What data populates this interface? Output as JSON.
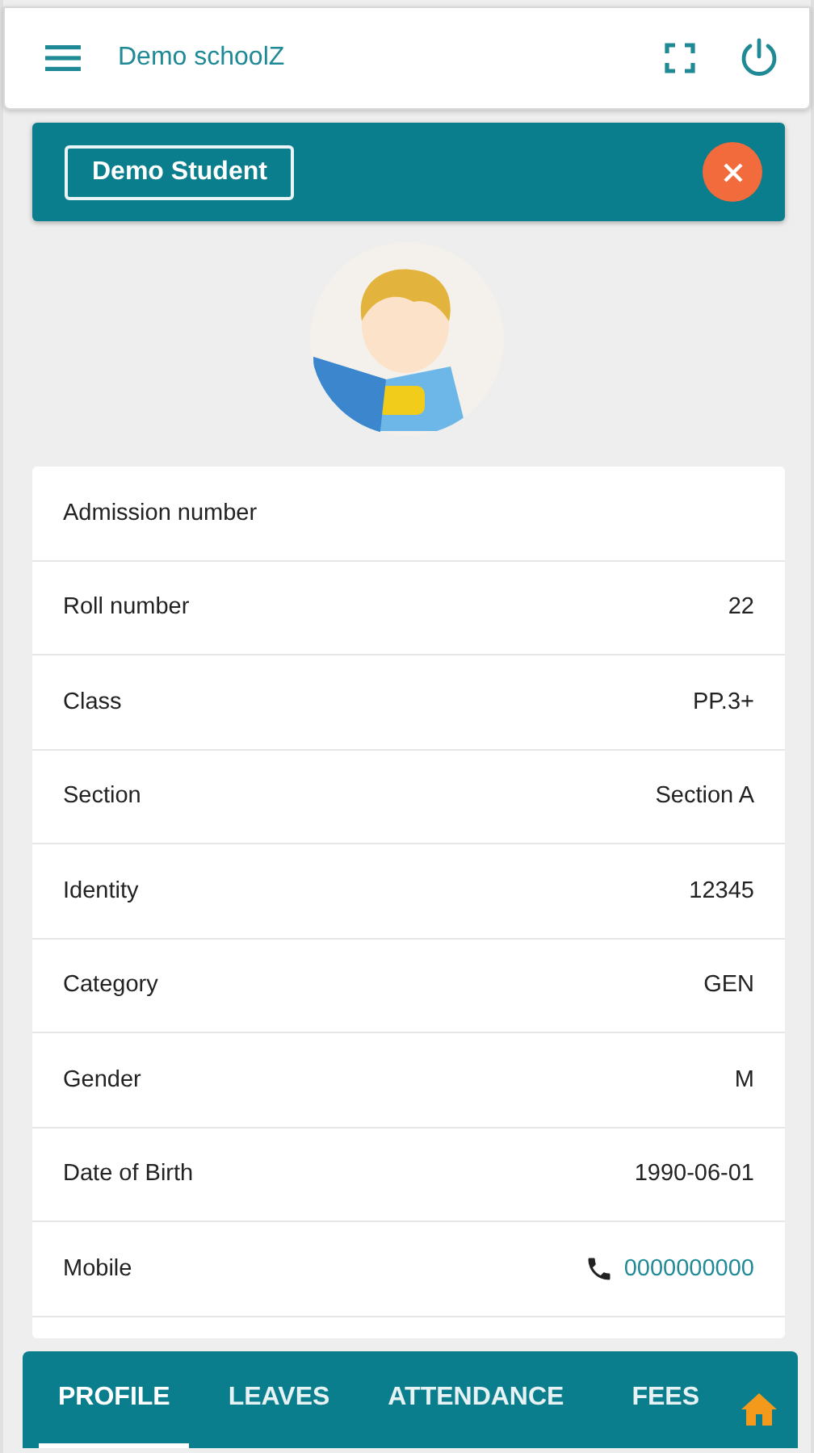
{
  "header": {
    "title": "Demo schoolZ"
  },
  "banner": {
    "name": "Demo Student"
  },
  "fields": [
    {
      "label": "Admission number"
    },
    {
      "label": "Roll number",
      "value": "22",
      "kind": "text"
    },
    {
      "label": "Class",
      "value": "PP.3+",
      "kind": "text"
    },
    {
      "label": "Section",
      "value": "Section A",
      "kind": "text"
    },
    {
      "label": "Identity",
      "value": "12345",
      "kind": "text"
    },
    {
      "label": "Category",
      "value": "GEN",
      "kind": "text"
    },
    {
      "label": "Gender",
      "value": "M",
      "kind": "text"
    },
    {
      "label": "Date of Birth",
      "value": "1990-06-01",
      "kind": "text"
    },
    {
      "label": "Mobile",
      "value": "0000000000",
      "kind": "phone"
    }
  ],
  "tabs": [
    {
      "label": "PROFILE",
      "selected": true
    },
    {
      "label": "LEAVES",
      "selected": false
    },
    {
      "label": "ATTENDANCE",
      "selected": false
    },
    {
      "label": "FEES",
      "selected": false
    }
  ]
}
